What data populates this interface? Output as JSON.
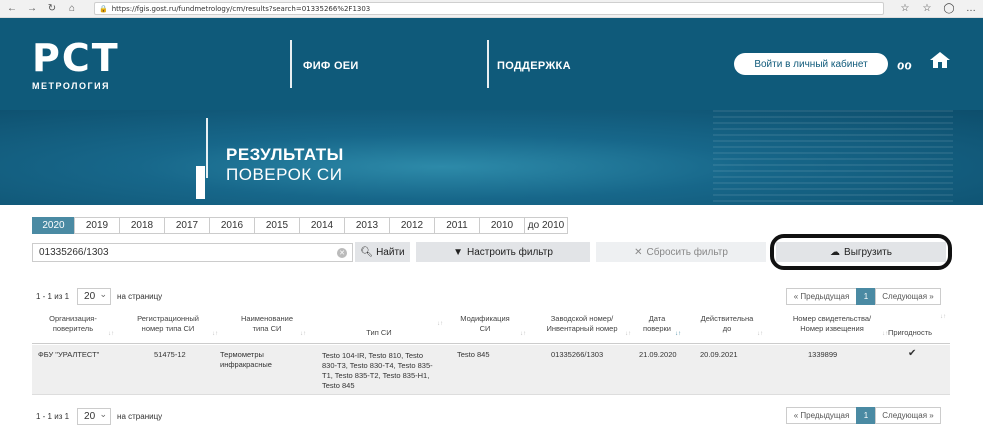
{
  "browser": {
    "url": "https://fgis.gost.ru/fundmetrology/cm/results?search=01335266%2F1303"
  },
  "header": {
    "logo": "РСТ",
    "logo_sub": "МЕТРОЛОГИЯ",
    "nav": [
      "ФИФ ОЕИ",
      "ПОДДЕРЖКА"
    ],
    "login": "Войти в личный кабинет",
    "page_title_1": "РЕЗУЛЬТАТЫ",
    "page_title_2": "ПОВЕРОК СИ"
  },
  "years": [
    "2020",
    "2019",
    "2018",
    "2017",
    "2016",
    "2015",
    "2014",
    "2013",
    "2012",
    "2011",
    "2010",
    "до 2010"
  ],
  "active_year": "2020",
  "search": {
    "value": "01335266/1303",
    "find": "Найти"
  },
  "actions": {
    "filter": "Настроить фильтр",
    "reset": "Сбросить фильтр",
    "export": "Выгрузить"
  },
  "paging": {
    "range": "1 - 1 из 1",
    "per_page": "20",
    "per_page_label": "на страницу",
    "prev": "« Предыдущая",
    "page": "1",
    "next": "Следующая »"
  },
  "columns": [
    "Организация-\nповеритель",
    "Регистрационный\nномер типа СИ",
    "Наименование\nтипа СИ",
    "Тип СИ",
    "Модификация\nСИ",
    "Заводской номер/\nИнвентарный номер",
    "Дата\nповерки",
    "Действительна\nдо",
    "Номер свидетельства/\nНомер извещения",
    "Пригодность"
  ],
  "rows": [
    {
      "org": "ФБУ \"УРАЛТЕСТ\"",
      "reg": "51475-12",
      "name": "Термометры\nинфракрасные",
      "type": "Testo 104-IR, Testo 810, Testo\n830-T3, Testo 830-T4, Testo 835-\nT1, Testo 835-T2, Testo 835-H1,\nTesto 845",
      "mod": "Testo 845",
      "serial": "01335266/1303",
      "date": "21.09.2020",
      "valid": "20.09.2021",
      "cert": "1339899",
      "fit": "✔"
    }
  ]
}
